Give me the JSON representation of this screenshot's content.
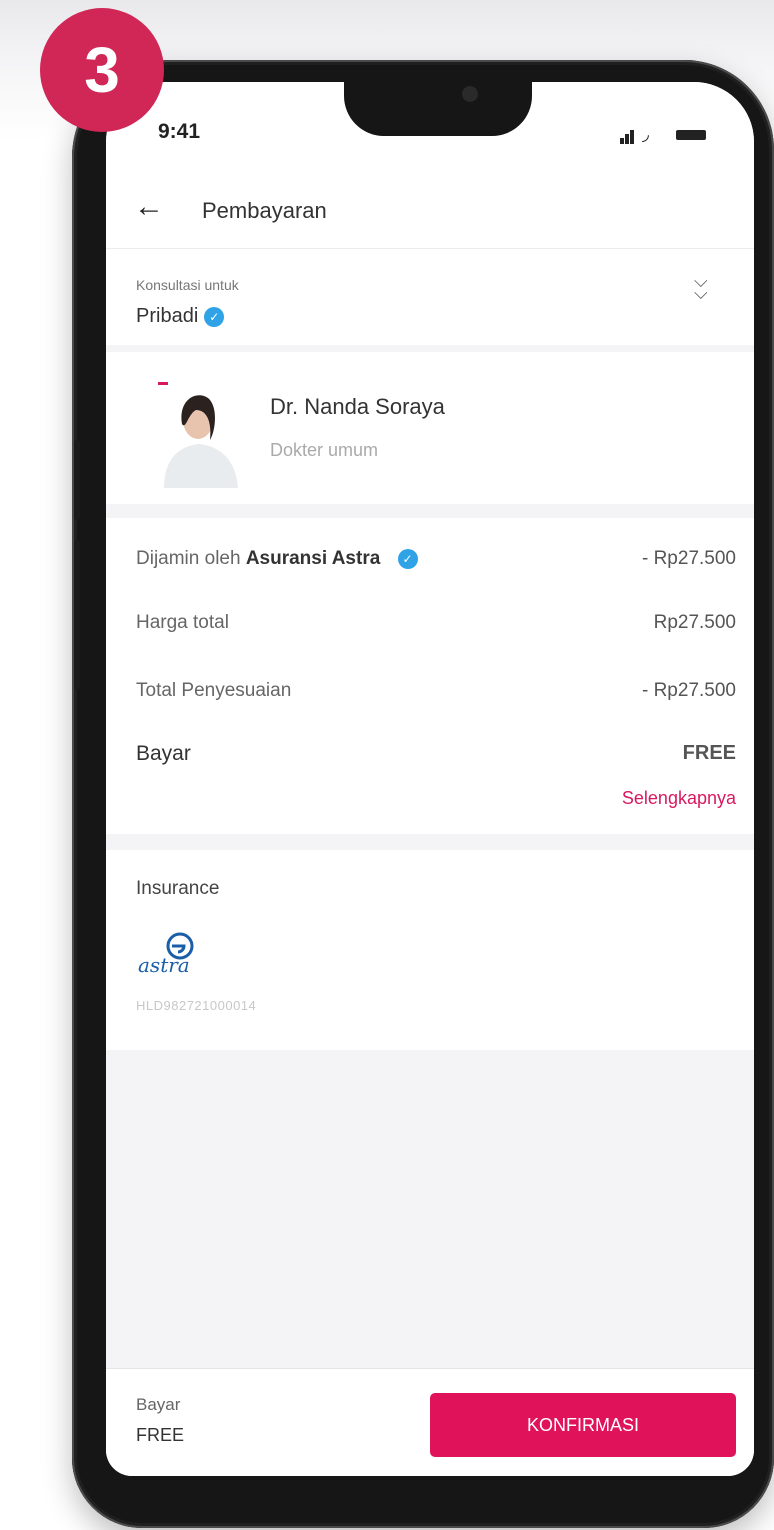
{
  "step_badge": "3",
  "status_bar": {
    "time": "9:41"
  },
  "header": {
    "title": "Pembayaran"
  },
  "consultation_for": {
    "label": "Konsultasi untuk",
    "value": "Pribadi"
  },
  "doctor": {
    "name": "Dr. Nanda Soraya",
    "specialty": "Dokter umum"
  },
  "pricing": {
    "guarantee_prefix": "Dijamin oleh ",
    "guarantee_insurer": "Asuransi Astra",
    "guarantee_amount": "- Rp27.500",
    "total_label": "Harga total",
    "total_value": "Rp27.500",
    "adjustment_label": "Total Penyesuaian",
    "adjustment_value": "- Rp27.500",
    "pay_label": "Bayar",
    "pay_value": "FREE",
    "more_link": "Selengkapnya"
  },
  "insurance": {
    "title": "Insurance",
    "logo_text": "astra",
    "policy_number": "HLD982721000014"
  },
  "footer": {
    "pay_label": "Bayar",
    "pay_value": "FREE",
    "confirm_label": "KONFIRMASI"
  },
  "colors": {
    "primary": "#e0135a",
    "free": "#1cc79a",
    "verified": "#2fa3e6",
    "badge": "#d02757"
  }
}
